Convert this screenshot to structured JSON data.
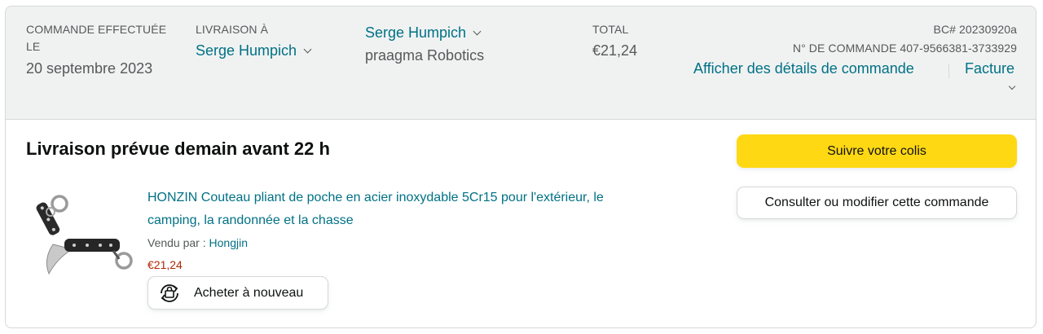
{
  "header": {
    "order_placed_label": "COMMANDE EFFECTUÉE LE",
    "order_placed_label_line1": "COMMANDE EFFECTUÉE",
    "order_placed_label_line2": "LE",
    "order_date": "20 septembre 2023",
    "ship_to_label": "LIVRAISON À",
    "ship_to_name": "Serge Humpich",
    "recipient_name": "Serge Humpich",
    "recipient_company": "praagma Robotics",
    "total_label": "TOTAL",
    "total_value": "€21,24",
    "po_number": "BC# 20230920a",
    "order_number": "N° DE COMMANDE 407-9566381-3733929",
    "details_link": "Afficher des détails de commande",
    "invoice_link": "Facture"
  },
  "shipment": {
    "status": "Livraison prévue demain avant 22 h",
    "track_button": "Suivre votre colis",
    "view_edit_button": "Consulter ou modifier cette commande"
  },
  "product": {
    "title_line1": "HONZIN Couteau pliant de poche en acier inoxydable 5Cr15 pour l'extérieur, le",
    "title_line2": "camping, la randonnée et la chasse",
    "sold_by_label": "Vendu par : ",
    "seller": "Hongjin",
    "price": "€21,24",
    "buy_again": "Acheter à nouveau"
  },
  "colors": {
    "link": "#007185",
    "price": "#b12704",
    "header_bg": "#f0f2f2",
    "primary_button": "#ffd814"
  }
}
